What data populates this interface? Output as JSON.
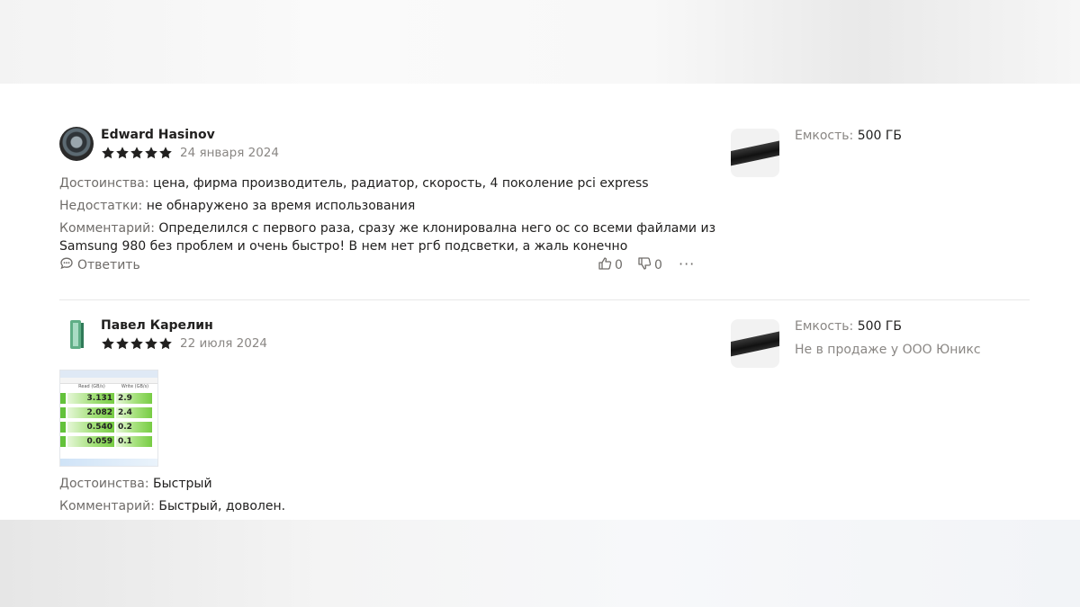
{
  "reviews": [
    {
      "author": "Edward Hasinov",
      "rating": 5,
      "date": "24 января 2024",
      "pros_label": "Достоинства:",
      "pros": " цена, фирма производитель, радиатор, скорость, 4 поколение pci express",
      "cons_label": "Недостатки:",
      "cons": " не обнаружено за время использования",
      "comment_label": "Комментарий:",
      "comment_line1": " Определился с первого раза, сразу же клонировална него ос со всеми файлами из",
      "comment_line2": "Samsung 980 без проблем и очень быстро! В нем нет ргб подсветки, а жаль конечно",
      "reply_label": "Ответить",
      "likes": "0",
      "dislikes": "0",
      "more_label": "···",
      "spec_label": "Емкость:",
      "spec_value": " 500 ГБ"
    },
    {
      "author": "Павел Карелин",
      "rating": 5,
      "date": "22 июля 2024",
      "pros_label": "Достоинства:",
      "pros": " Быстрый",
      "comment_label": "Комментарий:",
      "comment": " Быстрый, доволен.",
      "spec_label": "Емкость:",
      "spec_value": " 500 ГБ",
      "seller": "Не в продаже у ООО Юникс",
      "photo": {
        "read_header": "Read (GB/s)",
        "write_header": "Write (GB/s)",
        "rows": [
          {
            "read": "3.131",
            "write": "2.9"
          },
          {
            "read": "2.082",
            "write": "2.4"
          },
          {
            "read": "0.540",
            "write": "0.2"
          },
          {
            "read": "0.059",
            "write": "0.1"
          }
        ]
      }
    }
  ],
  "colors": {
    "star": "#21201f",
    "muted": "#6f6c69",
    "text": "#21201f"
  }
}
